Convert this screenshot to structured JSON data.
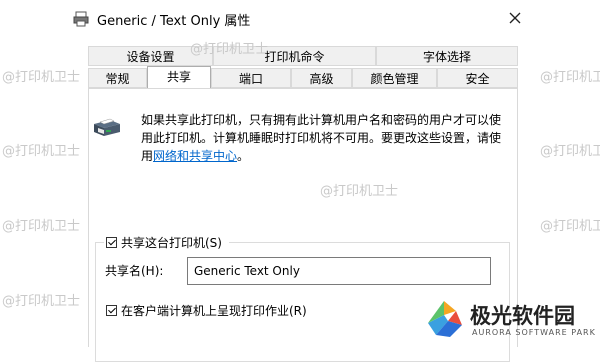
{
  "window": {
    "title": "Generic / Text Only 属性"
  },
  "tabs_top": [
    {
      "label": "设备设置"
    },
    {
      "label": "打印机命令"
    },
    {
      "label": "字体选择"
    }
  ],
  "tabs_bottom": [
    {
      "label": "常规"
    },
    {
      "label": "共享"
    },
    {
      "label": "端口"
    },
    {
      "label": "高级"
    },
    {
      "label": "颜色管理"
    },
    {
      "label": "安全"
    }
  ],
  "share": {
    "description_line1": "如果共享此打印机，只有拥有此计算机用户名和密码的用户才可以使",
    "description_line2": "用此打印机。计算机睡眠时打印机将不可用。要更改这些设置，请使",
    "description_line3_prefix": "用",
    "network_link": "网络和共享中心",
    "description_line3_suffix": "。",
    "share_checkbox_label": "共享这台打印机(S)",
    "share_name_label": "共享名(H):",
    "share_name_value": "Generic  Text Only",
    "render_jobs_label": "在客户端计算机上呈现打印作业(R)"
  },
  "watermark": {
    "text": "@打印机卫士"
  },
  "logo": {
    "name": "极光软件园",
    "subtitle": "AURORA SOFTWARE PARK"
  },
  "colors": {
    "link": "#0066cc",
    "tab_bg": "#f0f0f0",
    "border": "#d9d9d9"
  }
}
